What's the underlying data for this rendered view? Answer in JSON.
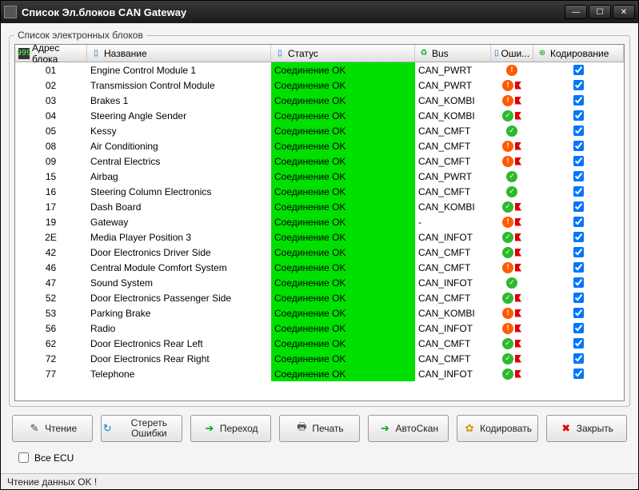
{
  "window_title": "Список Эл.блоков CAN Gateway",
  "group_title": "Список электронных блоков",
  "columns": {
    "addr": "Адрес блока",
    "name": "Название",
    "status": "Статус",
    "bus": "Bus",
    "err": "Оши...",
    "cod": "Кодирование"
  },
  "rows": [
    {
      "addr": "01",
      "name": "Engine Control Module 1",
      "status": "Соединение OK",
      "bus": "CAN_PWRT",
      "err": "err",
      "flag": false,
      "cod": true
    },
    {
      "addr": "02",
      "name": "Transmission Control Module",
      "status": "Соединение OK",
      "bus": "CAN_PWRT",
      "err": "err",
      "flag": true,
      "cod": true
    },
    {
      "addr": "03",
      "name": "Brakes 1",
      "status": "Соединение OK",
      "bus": "CAN_KOMBI",
      "err": "err",
      "flag": true,
      "cod": true
    },
    {
      "addr": "04",
      "name": "Steering Angle Sender",
      "status": "Соединение OK",
      "bus": "CAN_KOMBI",
      "err": "ok",
      "flag": true,
      "cod": true
    },
    {
      "addr": "05",
      "name": "Kessy",
      "status": "Соединение OK",
      "bus": "CAN_CMFT",
      "err": "ok",
      "flag": false,
      "cod": true
    },
    {
      "addr": "08",
      "name": "Air Conditioning",
      "status": "Соединение OK",
      "bus": "CAN_CMFT",
      "err": "err",
      "flag": true,
      "cod": true
    },
    {
      "addr": "09",
      "name": "Central Electrics",
      "status": "Соединение OK",
      "bus": "CAN_CMFT",
      "err": "err",
      "flag": true,
      "cod": true
    },
    {
      "addr": "15",
      "name": "Airbag",
      "status": "Соединение OK",
      "bus": "CAN_PWRT",
      "err": "ok",
      "flag": false,
      "cod": true
    },
    {
      "addr": "16",
      "name": "Steering Column Electronics",
      "status": "Соединение OK",
      "bus": "CAN_CMFT",
      "err": "ok",
      "flag": false,
      "cod": true
    },
    {
      "addr": "17",
      "name": "Dash Board",
      "status": "Соединение OK",
      "bus": "CAN_KOMBI",
      "err": "ok",
      "flag": true,
      "cod": true
    },
    {
      "addr": "19",
      "name": "Gateway",
      "status": "Соединение OK",
      "bus": "-",
      "err": "err",
      "flag": true,
      "cod": true
    },
    {
      "addr": "2E",
      "name": "Media Player Position 3",
      "status": "Соединение OK",
      "bus": "CAN_INFOT",
      "err": "ok",
      "flag": true,
      "cod": true
    },
    {
      "addr": "42",
      "name": "Door Electronics Driver Side",
      "status": "Соединение OK",
      "bus": "CAN_CMFT",
      "err": "ok",
      "flag": true,
      "cod": true
    },
    {
      "addr": "46",
      "name": "Central Module Comfort System",
      "status": "Соединение OK",
      "bus": "CAN_CMFT",
      "err": "err",
      "flag": true,
      "cod": true
    },
    {
      "addr": "47",
      "name": "Sound System",
      "status": "Соединение OK",
      "bus": "CAN_INFOT",
      "err": "ok",
      "flag": false,
      "cod": true
    },
    {
      "addr": "52",
      "name": "Door Electronics Passenger Side",
      "status": "Соединение OK",
      "bus": "CAN_CMFT",
      "err": "ok",
      "flag": true,
      "cod": true
    },
    {
      "addr": "53",
      "name": "Parking Brake",
      "status": "Соединение OK",
      "bus": "CAN_KOMBI",
      "err": "err",
      "flag": true,
      "cod": true
    },
    {
      "addr": "56",
      "name": "Radio",
      "status": "Соединение OK",
      "bus": "CAN_INFOT",
      "err": "err",
      "flag": true,
      "cod": true
    },
    {
      "addr": "62",
      "name": "Door Electronics Rear Left",
      "status": "Соединение OK",
      "bus": "CAN_CMFT",
      "err": "ok",
      "flag": true,
      "cod": true
    },
    {
      "addr": "72",
      "name": "Door Electronics Rear Right",
      "status": "Соединение OK",
      "bus": "CAN_CMFT",
      "err": "ok",
      "flag": true,
      "cod": true
    },
    {
      "addr": "77",
      "name": "Telephone",
      "status": "Соединение OK",
      "bus": "CAN_INFOT",
      "err": "ok",
      "flag": true,
      "cod": true
    }
  ],
  "buttons": {
    "read": "Чтение",
    "clear": "Стереть Ошибки",
    "goto": "Переход",
    "print": "Печать",
    "autoscan": "АвтоСкан",
    "code": "Кодировать",
    "close": "Закрыть"
  },
  "all_ecu_label": "Все ECU",
  "statusbar": "Чтение данных OK !"
}
